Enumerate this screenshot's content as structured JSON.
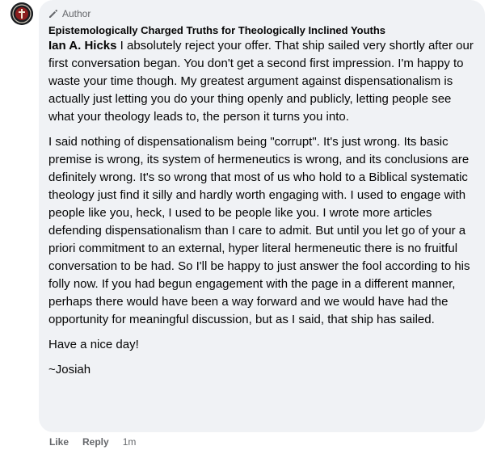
{
  "comment": {
    "badge_label": "Author",
    "page_name": "Epistemologically Charged Truths for Theologically Inclined Youths",
    "mention": "Ian A. Hicks",
    "paragraphs": [
      " I absolutely reject your offer. That ship sailed very shortly after our first conversation began. You don't get a second first impression. I'm happy to waste your time though. My greatest argument against dispensationalism is actually just letting you do your thing openly and publicly, letting people see what your theology leads to, the person it turns you into.",
      "I said nothing of dispensationalism being \"corrupt\". It's just wrong. Its basic premise is wrong, its system of hermeneutics is wrong, and its conclusions are definitely wrong. It's so wrong that most of us who hold to a Biblical systematic theology just find it silly and hardly worth engaging with. I used to engage with people like you, heck, I used to be people like you. I wrote more articles defending dispensationalism than I care to admit. But until you let go of your a priori commitment to an external, hyper literal hermeneutic there is no fruitful conversation to be had. So I'll be happy to just answer the fool according to his folly now. If you had begun engagement with the page in a different manner, perhaps there would have been a way forward and we would have had the opportunity for meaningful discussion, but as I said, that ship has sailed.",
      "Have a nice day!",
      "~Josiah"
    ],
    "actions": {
      "like": "Like",
      "reply": "Reply",
      "time": "1m"
    }
  }
}
